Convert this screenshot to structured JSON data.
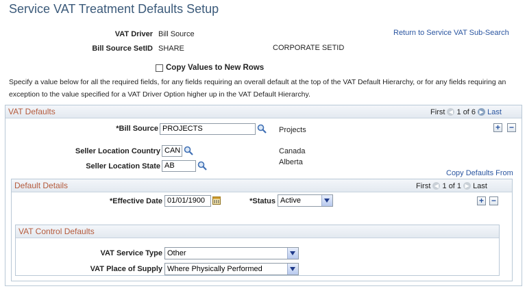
{
  "page": {
    "title": "Service VAT Treatment Defaults Setup",
    "vat_driver_label": "VAT Driver",
    "vat_driver_value": "Bill Source",
    "setid_label": "Bill Source SetID",
    "setid_value": "SHARE",
    "setid_desc": "CORPORATE SETID",
    "return_link": "Return to Service VAT Sub-Search",
    "copy_values_label": "Copy Values to New Rows",
    "instructions": "Specify a value below for all the required fields, for any fields requiring an overall default at the top of the VAT Default Hierarchy, or for any fields requiring an exception to the value specified for a VAT Driver Option higher up in the VAT Default Hierarchy."
  },
  "vat_defaults": {
    "title": "VAT Defaults",
    "nav": {
      "first": "First",
      "count": "1 of 6",
      "last": "Last"
    },
    "bill_source_label": "*Bill Source",
    "bill_source_value": "PROJECTS",
    "bill_source_desc": "Projects",
    "country_label": "Seller Location Country",
    "country_value": "CAN",
    "country_desc": "Canada",
    "state_label": "Seller Location State",
    "state_value": "AB",
    "state_desc": "Alberta",
    "copy_defaults_link": "Copy Defaults From"
  },
  "default_details": {
    "title": "Default Details",
    "nav": {
      "first": "First",
      "count": "1 of 1",
      "last": "Last"
    },
    "eff_date_label": "*Effective Date",
    "eff_date_value": "01/01/1900",
    "status_label": "*Status",
    "status_value": "Active"
  },
  "vat_control": {
    "title": "VAT Control Defaults",
    "service_type_label": "VAT Service Type",
    "service_type_value": "Other",
    "place_label": "VAT Place of Supply",
    "place_value": "Where Physically Performed"
  },
  "icons": {
    "lookup": "magnifier-icon",
    "calendar": "calendar-icon",
    "add": "plus-icon",
    "delete": "minus-icon",
    "prev": "prev-arrow-icon",
    "next": "next-arrow-icon"
  }
}
